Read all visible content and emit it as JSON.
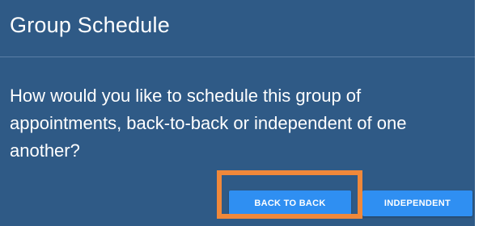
{
  "dialog": {
    "title": "Group Schedule",
    "message": "How would you like to schedule this group of appointments, back-to-back or independent of one another?",
    "buttons": {
      "back_to_back": "BACK TO BACK",
      "independent": "INDEPENDENT"
    }
  },
  "colors": {
    "dialog_background": "#2f5a86",
    "button_background": "#2f8ff2",
    "highlight": "#f0883a"
  }
}
